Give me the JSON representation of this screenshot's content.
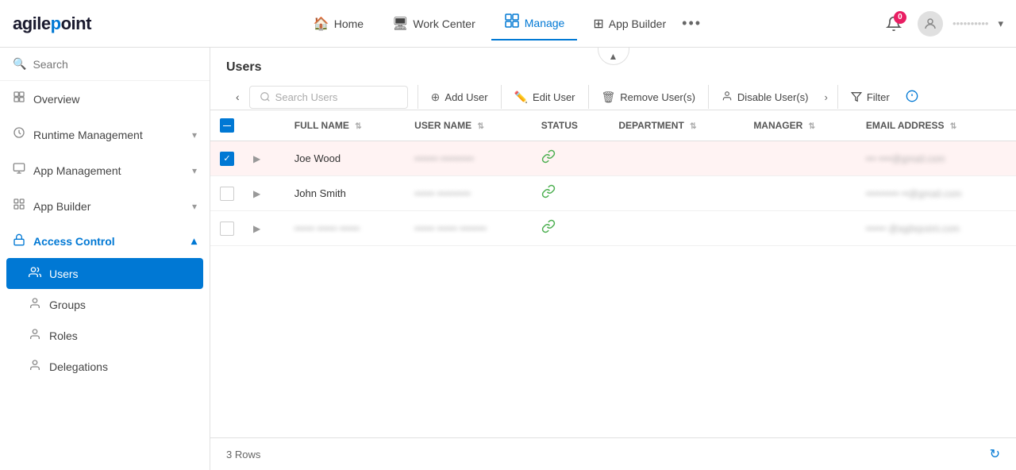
{
  "logo": {
    "text": "agilepoint"
  },
  "topnav": {
    "items": [
      {
        "id": "home",
        "label": "Home",
        "icon": "🏠",
        "active": false
      },
      {
        "id": "workcenter",
        "label": "Work Center",
        "icon": "🖥",
        "active": false
      },
      {
        "id": "manage",
        "label": "Manage",
        "icon": "📋",
        "active": true
      },
      {
        "id": "appbuilder",
        "label": "App Builder",
        "icon": "⊞",
        "active": false
      }
    ],
    "more_icon": "•••",
    "notification_count": "0",
    "user_name": "••••••••••"
  },
  "sidebar": {
    "search_placeholder": "Search",
    "items": [
      {
        "id": "overview",
        "label": "Overview",
        "icon": "▦",
        "expandable": false
      },
      {
        "id": "runtime-management",
        "label": "Runtime Management",
        "icon": "⏱",
        "expandable": true
      },
      {
        "id": "app-management",
        "label": "App Management",
        "icon": "💼",
        "expandable": true
      },
      {
        "id": "app-builder",
        "label": "App Builder",
        "icon": "⊞",
        "expandable": true
      },
      {
        "id": "access-control",
        "label": "Access Control",
        "icon": "🔒",
        "expandable": true,
        "active": true
      }
    ],
    "sub_items": [
      {
        "id": "users",
        "label": "Users",
        "icon": "👥",
        "active": true
      },
      {
        "id": "groups",
        "label": "Groups",
        "icon": "👤",
        "active": false
      },
      {
        "id": "roles",
        "label": "Roles",
        "icon": "👤",
        "active": false
      },
      {
        "id": "delegations",
        "label": "Delegations",
        "icon": "👤",
        "active": false
      }
    ]
  },
  "content": {
    "title": "Users",
    "toolbar": {
      "back_label": "‹",
      "search_placeholder": "Search Users",
      "add_user_label": "Add User",
      "edit_user_label": "Edit User",
      "remove_users_label": "Remove User(s)",
      "disable_users_label": "Disable User(s)",
      "filter_label": "Filter",
      "more_label": "›"
    },
    "table": {
      "columns": [
        {
          "id": "fullname",
          "label": "FULL NAME"
        },
        {
          "id": "username",
          "label": "USER NAME"
        },
        {
          "id": "status",
          "label": "STATUS"
        },
        {
          "id": "department",
          "label": "DEPARTMENT"
        },
        {
          "id": "manager",
          "label": "MANAGER"
        },
        {
          "id": "email",
          "label": "EMAIL ADDRESS"
        }
      ],
      "rows": [
        {
          "id": 1,
          "selected": true,
          "full_name": "Joe Wood",
          "username_blurred": "••••••• ••••••••••",
          "status": "active",
          "department": "",
          "manager": "",
          "email_blurred": "••• ••••@gmail.com"
        },
        {
          "id": 2,
          "selected": false,
          "full_name": "John Smith",
          "username_blurred": "•••••• ••••••••••",
          "status": "active",
          "department": "",
          "manager": "",
          "email_blurred": "•••••••••• ••@gmail.com"
        },
        {
          "id": 3,
          "selected": false,
          "full_name_blurred": "•••••• •••••• ••••••",
          "username_blurred": "•••••• •••••• ••••••••",
          "status": "active",
          "department": "",
          "manager": "",
          "email_blurred": "•••••• @agilepoint.com"
        }
      ]
    },
    "footer": {
      "row_count": "3 Rows"
    }
  }
}
